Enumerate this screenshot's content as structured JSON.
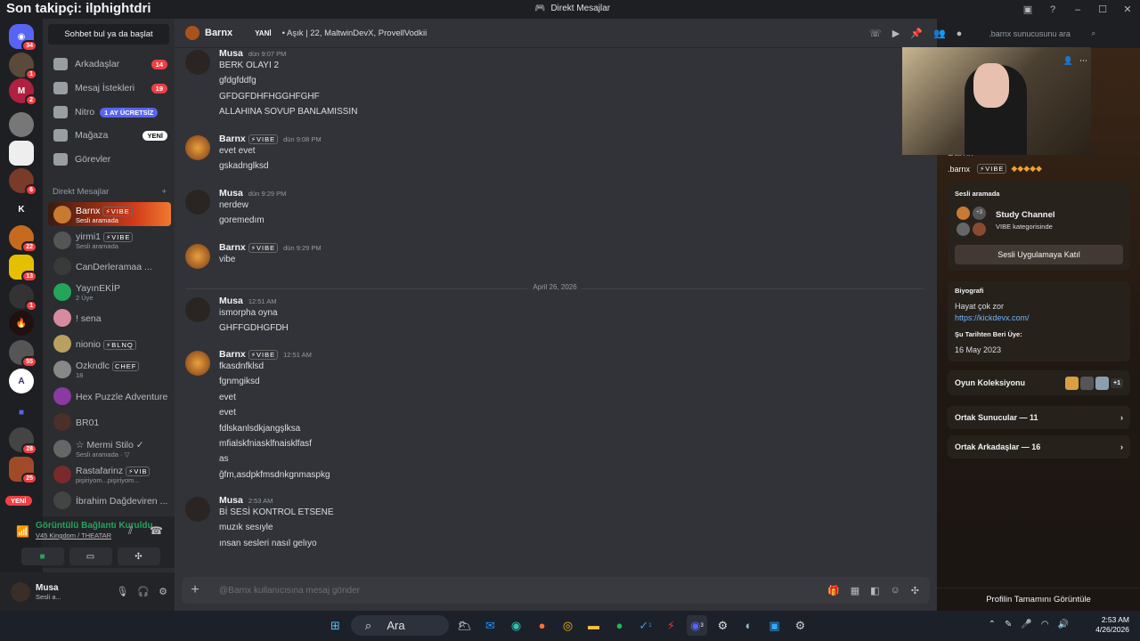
{
  "overlay_title": "Son takipçi: ilphightdri",
  "window": {
    "title": "Direkt Mesajlar"
  },
  "guild_badges": [
    "34",
    "1",
    "2",
    "",
    "",
    "6",
    "",
    "22",
    "13",
    "1",
    "",
    "55",
    "",
    "",
    "28",
    "25"
  ],
  "guild_new": "YENİ",
  "guild_k": "K",
  "dm": {
    "search": "Sohbet bul ya da başlat",
    "nav": [
      {
        "label": "Arkadaşlar",
        "badge": "14"
      },
      {
        "label": "Mesaj İstekleri",
        "badge": "19"
      },
      {
        "label": "Nitro",
        "badge": "1 AY ÜCRETSİZ"
      },
      {
        "label": "Mağaza",
        "badge": "YENİ"
      },
      {
        "label": "Görevler",
        "badge": ""
      }
    ],
    "header": "Direkt Mesajlar",
    "header_add": "+",
    "items": [
      {
        "name": "Barnx",
        "tag": "⚡VIBE",
        "sub": "Sesli aramada"
      },
      {
        "name": "yirmi1",
        "tag": "⚡VIBE",
        "sub": "Sesli aramada"
      },
      {
        "name": "CanDerleramaa ...",
        "tag": "",
        "sub": ""
      },
      {
        "name": "YayınEKİP",
        "tag": "",
        "sub": "2 Üye"
      },
      {
        "name": "! sena",
        "tag": "",
        "sub": ""
      },
      {
        "name": "nionio",
        "tag": "⚡BLNQ",
        "sub": ""
      },
      {
        "name": "Ozkndlc",
        "tag": "CHEF",
        "sub": "18"
      },
      {
        "name": "Hex Puzzle Adventure",
        "tag": "",
        "sub": ""
      },
      {
        "name": "BR01",
        "tag": "",
        "sub": ""
      },
      {
        "name": "☆ Mermi Stilo ✓",
        "tag": "",
        "sub": "Sesli aramada · ▽"
      },
      {
        "name": "Rastafarinz",
        "tag": "⚡VIB",
        "sub": "pişiriyom...pişiriyom..."
      },
      {
        "name": "İbrahim Dağdeviren ...",
        "tag": "",
        "sub": ""
      }
    ]
  },
  "voice": {
    "title": "Görüntülü Bağlantı Kuruldu",
    "sub": "V45 Kingdom / THEATAR"
  },
  "user": {
    "name": "Musa",
    "status": "Sesli a..."
  },
  "chat": {
    "name": "Barnx",
    "new_label": "YANİ",
    "desc": "• Aşık | 22, MaltwinDevX, ProvellVodkii",
    "search_placeholder": ".barnx sunucusunu ara",
    "date_divider": "April 26, 2026",
    "composer_placeholder": "@Barnx kullanıcısına mesaj gönder",
    "messages": [
      {
        "author": "Musa",
        "time": "dün 9:07 PM",
        "tag": "",
        "lines": [
          "BERK OLAYI 2",
          "gfdgfddfg",
          "GFDGFDHFHGGHFGHF",
          "ALLAHINA SOVUP BANLAMISSIN"
        ]
      },
      {
        "author": "Barnx",
        "time": "dün 9:08 PM",
        "tag": "⚡VIBE",
        "lines": [
          "evet evet",
          "gskadnglksd"
        ]
      },
      {
        "author": "Musa",
        "time": "dün 9:29 PM",
        "tag": "",
        "lines": [
          "nerdew",
          "goremedım"
        ]
      },
      {
        "author": "Barnx",
        "time": "dün 9:29 PM",
        "tag": "⚡VIBE",
        "lines": [
          "vibe"
        ]
      },
      {
        "author": "Musa",
        "time": "12:51 AM",
        "tag": "",
        "lines": [
          "ismorpha oyna",
          "GHFFGDHGFDH"
        ]
      },
      {
        "author": "Barnx",
        "time": "12:51 AM",
        "tag": "⚡VIBE",
        "lines": [
          "fkasdnfklsd",
          "fgnmgiksd",
          "evet",
          "evet",
          "fdlskanlsdkjangşlksa",
          "mfialskfniasklfnaisklfasf",
          "as",
          "ğfm,asdpkfmsdnkgnmaspkg"
        ]
      },
      {
        "author": "Musa",
        "time": "2:53 AM",
        "tag": "",
        "lines": [
          "Bİ SESİ KONTROL ETSENE",
          "muzık sesıyle",
          "ınsan sesleri nasıl gelıyo"
        ]
      }
    ]
  },
  "profile": {
    "display_name": "Barnx",
    "username": ".barnx",
    "tag": "⚡VIBE",
    "voice_label": "Sesli aramada",
    "voice_channel": "Study Channel",
    "voice_category": "VIBE kategorisinde",
    "voice_more": "+3",
    "join_button": "Sesli Uygulamaya Katıl",
    "bio_label": "Biyografi",
    "bio_text": "Hayat çok zor",
    "bio_link": "https://kickdevx.com/",
    "member_since_label": "Şu Tarihten Beri Üye:",
    "member_since": "16 May 2023",
    "games_label": "Oyun Koleksiyonu",
    "games_more": "+1",
    "mutual_servers": "Ortak Sunucular — 11",
    "mutual_friends": "Ortak Arkadaşlar — 16",
    "footer": "Profilin Tamamını Görüntüle"
  },
  "taskbar": {
    "search": "Ara",
    "time": "2:53 AM",
    "date": "4/26/2026",
    "spotify_badge": "1",
    "discord_badge": "3"
  }
}
